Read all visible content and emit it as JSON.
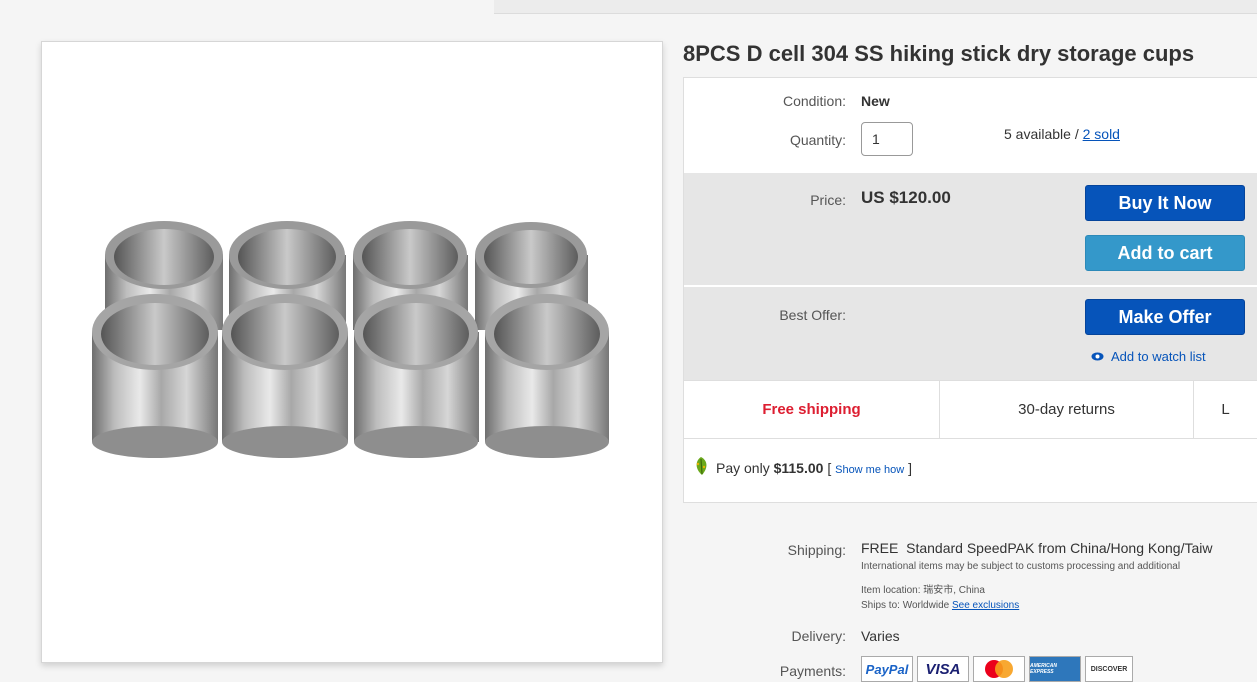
{
  "listing": {
    "title": "8PCS D cell 304 SS hiking stick dry storage cups",
    "condition_label": "Condition:",
    "condition_value": "New",
    "quantity_label": "Quantity:",
    "quantity_value": "1",
    "available_text": "5 available / ",
    "sold_link": "2 sold"
  },
  "purchase": {
    "price_label": "Price:",
    "price_value": "US $120.00",
    "buy_now": "Buy It Now",
    "add_to_cart": "Add to cart",
    "best_offer_label": "Best Offer:",
    "make_offer": "Make Offer",
    "watch_list": "Add to watch list"
  },
  "features": {
    "free_shipping": "Free shipping",
    "returns": "30-day returns",
    "third": "L",
    "free_shipping_color": "#dd1e31"
  },
  "promo": {
    "prefix": "Pay only ",
    "amount": "$115.00",
    "bracket_open": " [ ",
    "link": "Show me how",
    "bracket_close": " ]"
  },
  "shipping": {
    "label": "Shipping:",
    "free": "FREE",
    "service": "Standard SpeedPAK from China/Hong Kong/Taiw",
    "intl_note": "International items may be subject to customs processing and additional",
    "item_location": "Item location:  瑞安市, China",
    "ships_to": "Ships to:  Worldwide  ",
    "exclusions_link": "See exclusions",
    "delivery_label": "Delivery:",
    "delivery_value": "Varies",
    "payments_label": "Payments:"
  },
  "payment_logos": [
    "PayPal",
    "VISA",
    "mastercard-logo",
    "AMERICAN EXPRESS",
    "DISCOVER"
  ],
  "colors": {
    "accent_blue": "#0654ba",
    "cart_blue": "#3498ca",
    "band_gray": "#e6e6e6"
  }
}
